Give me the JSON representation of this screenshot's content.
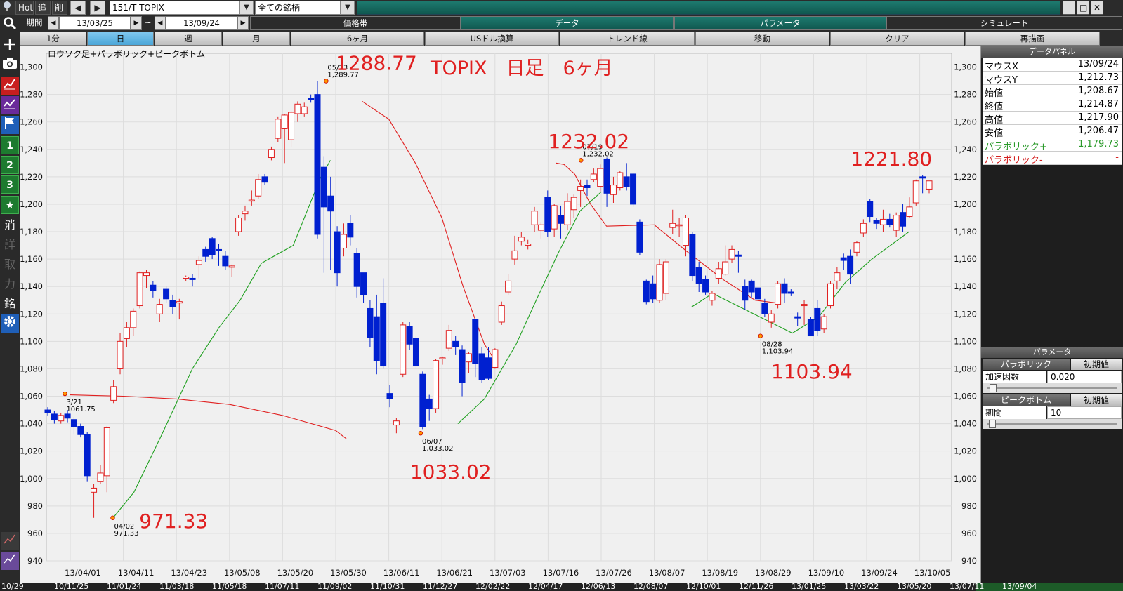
{
  "toolbar": {
    "hot": "Hot",
    "add": "追",
    "del": "削",
    "symbol": "151/T TOPIX",
    "universe": "全ての銘柄",
    "period_label": "期間",
    "date_from": "13/03/25",
    "tilde": "~",
    "date_to": "13/09/24"
  },
  "header_tabs": [
    "価格帯",
    "データ",
    "パラメータ",
    "シミュレート"
  ],
  "interval_tabs": [
    "1分",
    "日",
    "週",
    "月",
    "6ヶ月",
    "USドル換算",
    "トレンド線",
    "移動",
    "クリア",
    "再描画"
  ],
  "leftbar": [
    "1",
    "2",
    "3",
    "★",
    "消",
    "詳",
    "取",
    "力",
    "銘"
  ],
  "chart": {
    "subtitle": "ロウソク足+パラボリック+ピークボトム",
    "title": "TOPIX　日足　6ヶ月"
  },
  "chart_data": {
    "type": "candlestick",
    "title": "TOPIX　日足　6ヶ月",
    "ylim": [
      940,
      1310
    ],
    "yticks": [
      940,
      960,
      980,
      1000,
      1020,
      1040,
      1060,
      1080,
      1100,
      1120,
      1140,
      1160,
      1180,
      1200,
      1220,
      1240,
      1260,
      1280,
      1300
    ],
    "xticks": [
      "13/04/01",
      "13/04/11",
      "13/04/23",
      "13/05/08",
      "13/05/20",
      "13/05/30",
      "13/06/11",
      "13/06/21",
      "13/07/03",
      "13/07/16",
      "13/07/26",
      "13/08/07",
      "13/08/19",
      "13/08/29",
      "13/09/10",
      "13/09/24",
      "13/10/05"
    ],
    "big_labels": [
      {
        "text": "1288.77",
        "x": 5,
        "y": 1298
      },
      {
        "text": "1232.02",
        "x": 9,
        "y": 1241
      },
      {
        "text": "1221.80",
        "x": 14.7,
        "y": 1228
      },
      {
        "text": "1103.94",
        "x": 13.2,
        "y": 1073
      },
      {
        "text": "1033.02",
        "x": 6.4,
        "y": 1000
      },
      {
        "text": "971.33",
        "x": 1.3,
        "y": 964
      }
    ],
    "peaks": [
      {
        "date": "05/23",
        "value": "1,289.77",
        "x": 4.82,
        "y": 1289.77
      },
      {
        "date": "06/07",
        "value": "1,033.02",
        "x": 6.6,
        "y": 1033.02
      },
      {
        "date": "07/19",
        "value": "1,232.02",
        "x": 9.62,
        "y": 1232.02
      },
      {
        "date": "08/28",
        "value": "1,103.94",
        "x": 13.0,
        "y": 1103.94
      },
      {
        "date": "04/02",
        "value": "971.33",
        "x": 0.8,
        "y": 971.33
      },
      {
        "date": "3/21",
        "value": "1061.75",
        "x": -0.1,
        "y": 1061.75
      }
    ],
    "candles": [
      [
        1050,
        1048,
        1052,
        1046
      ],
      [
        1047,
        1043,
        1049,
        1040
      ],
      [
        1042,
        1046,
        1048,
        1040
      ],
      [
        1047,
        1044,
        1050,
        1041
      ],
      [
        1043,
        1038,
        1045,
        1032
      ],
      [
        1038,
        1032,
        1040,
        1030
      ],
      [
        1032,
        1002,
        1034,
        998
      ],
      [
        990,
        993,
        996,
        971.33
      ],
      [
        998,
        1004,
        1010,
        996
      ],
      [
        1002,
        1037,
        1038,
        990
      ],
      [
        1057,
        1067,
        1072,
        1055
      ],
      [
        1080,
        1100,
        1106,
        1076
      ],
      [
        1102,
        1110,
        1114,
        1096
      ],
      [
        1110,
        1122,
        1124,
        1104
      ],
      [
        1126,
        1150,
        1151,
        1124
      ],
      [
        1148,
        1150,
        1152,
        1139
      ],
      [
        1141,
        1137,
        1144,
        1132
      ],
      [
        1120,
        1127,
        1131,
        1114
      ],
      [
        1138,
        1131,
        1140,
        1128
      ],
      [
        1130,
        1125,
        1134,
        1120
      ],
      [
        1128,
        1129,
        1131,
        1116
      ],
      [
        1146,
        1147,
        1148,
        1144
      ],
      [
        1146,
        1145,
        1149,
        1140
      ],
      [
        1156,
        1159,
        1162,
        1146
      ],
      [
        1167,
        1162,
        1169,
        1158
      ],
      [
        1175,
        1163,
        1176,
        1160
      ],
      [
        1167,
        1166,
        1171,
        1155
      ],
      [
        1162,
        1155,
        1166,
        1152
      ],
      [
        1154,
        1155,
        1156,
        1147
      ],
      [
        1180,
        1190,
        1192,
        1177
      ],
      [
        1193,
        1195,
        1199,
        1188
      ],
      [
        1203,
        1203,
        1210,
        1199
      ],
      [
        1206,
        1218,
        1222,
        1204
      ],
      [
        1220,
        1216,
        1222,
        1214
      ],
      [
        1234,
        1240,
        1242,
        1232
      ],
      [
        1248,
        1262,
        1264,
        1245
      ],
      [
        1255,
        1265,
        1266,
        1230
      ],
      [
        1247,
        1267,
        1268,
        1242
      ],
      [
        1266,
        1273,
        1275,
        1260
      ],
      [
        1266,
        1271,
        1274,
        1264
      ],
      [
        1277,
        1276,
        1280,
        1274
      ],
      [
        1280,
        1178,
        1289.77,
        1175
      ],
      [
        1227,
        1198,
        1235,
        1150
      ],
      [
        1206,
        1195,
        1220,
        1152
      ],
      [
        1180,
        1150,
        1184,
        1140
      ],
      [
        1168,
        1178,
        1186,
        1162
      ],
      [
        1186,
        1176,
        1192,
        1170
      ],
      [
        1164,
        1140,
        1168,
        1132
      ],
      [
        1150,
        1134,
        1150,
        1128
      ],
      [
        1124,
        1103,
        1130,
        1096
      ],
      [
        1118,
        1086,
        1134,
        1076
      ],
      [
        1128,
        1082,
        1146,
        1080
      ],
      [
        1062,
        1058,
        1068,
        1052
      ],
      [
        1039,
        1042,
        1044,
        1033.02
      ],
      [
        1076,
        1112,
        1114,
        1074
      ],
      [
        1111,
        1098,
        1114,
        1094
      ],
      [
        1102,
        1082,
        1104,
        1080
      ],
      [
        1076,
        1038,
        1078,
        1036
      ],
      [
        1058,
        1051,
        1061,
        1042
      ],
      [
        1051,
        1086,
        1087,
        1048
      ],
      [
        1088,
        1088,
        1089,
        1083
      ],
      [
        1095,
        1108,
        1112,
        1093
      ],
      [
        1100,
        1096,
        1104,
        1090
      ],
      [
        1094,
        1070,
        1097,
        1060
      ],
      [
        1085,
        1091,
        1092,
        1077
      ],
      [
        1116,
        1084,
        1116,
        1074
      ],
      [
        1091,
        1072,
        1096,
        1070
      ],
      [
        1088,
        1073,
        1096,
        1072
      ],
      [
        1081,
        1094,
        1095,
        1080
      ],
      [
        1114,
        1126,
        1129,
        1112
      ],
      [
        1136,
        1144,
        1149,
        1134
      ],
      [
        1160,
        1166,
        1177,
        1156
      ],
      [
        1173,
        1176,
        1180,
        1170
      ],
      [
        1170,
        1171,
        1174,
        1167
      ],
      [
        1185,
        1195,
        1198,
        1180
      ],
      [
        1181,
        1185,
        1187,
        1175
      ],
      [
        1205,
        1180,
        1210,
        1176
      ],
      [
        1182,
        1199,
        1200,
        1176
      ],
      [
        1192,
        1186,
        1199,
        1175
      ],
      [
        1185,
        1202,
        1208,
        1181
      ],
      [
        1196,
        1205,
        1207,
        1190
      ],
      [
        1210,
        1213,
        1218,
        1198
      ],
      [
        1214,
        1212,
        1218,
        1206
      ],
      [
        1218,
        1222,
        1226,
        1216
      ],
      [
        1213,
        1226,
        1229,
        1209
      ],
      [
        1233,
        1208,
        1234,
        1198
      ],
      [
        1207,
        1214,
        1220,
        1201
      ],
      [
        1212,
        1223,
        1224,
        1210
      ],
      [
        1220,
        1213,
        1230,
        1210
      ],
      [
        1222,
        1200,
        1223,
        1198
      ],
      [
        1187,
        1165,
        1189,
        1163
      ],
      [
        1144,
        1129,
        1145,
        1127
      ],
      [
        1142,
        1131,
        1148,
        1128
      ],
      [
        1130,
        1156,
        1160,
        1128
      ],
      [
        1135,
        1158,
        1160,
        1130
      ],
      [
        1183,
        1186,
        1196,
        1178
      ],
      [
        1185,
        1185,
        1190,
        1176
      ],
      [
        1170,
        1190,
        1192,
        1162
      ],
      [
        1178,
        1148,
        1180,
        1144
      ],
      [
        1154,
        1142,
        1158,
        1136
      ],
      [
        1145,
        1136,
        1148,
        1134
      ],
      [
        1130,
        1135,
        1137,
        1126
      ],
      [
        1146,
        1153,
        1158,
        1142
      ],
      [
        1149,
        1158,
        1170,
        1148
      ],
      [
        1160,
        1167,
        1170,
        1157
      ],
      [
        1163,
        1162,
        1166,
        1150
      ],
      [
        1140,
        1130,
        1145,
        1123
      ],
      [
        1144,
        1136,
        1145,
        1132
      ],
      [
        1139,
        1131,
        1147,
        1120
      ],
      [
        1128,
        1120,
        1131,
        1118
      ],
      [
        1114,
        1120,
        1123,
        1110
      ],
      [
        1127,
        1142,
        1144,
        1124
      ],
      [
        1142,
        1135,
        1146,
        1128
      ],
      [
        1136,
        1135,
        1138,
        1133
      ],
      [
        1118,
        1117,
        1121,
        1111
      ],
      [
        1126,
        1127,
        1130,
        1112
      ],
      [
        1116,
        1104,
        1118,
        1103.94
      ],
      [
        1124,
        1108,
        1130,
        1104
      ],
      [
        1109,
        1118,
        1120,
        1106
      ],
      [
        1126,
        1142,
        1144,
        1124
      ],
      [
        1144,
        1150,
        1154,
        1138
      ],
      [
        1161,
        1159,
        1164,
        1152
      ],
      [
        1162,
        1149,
        1167,
        1142
      ],
      [
        1165,
        1172,
        1173,
        1162
      ],
      [
        1179,
        1186,
        1189,
        1176
      ],
      [
        1202,
        1191,
        1204,
        1187
      ],
      [
        1188,
        1186,
        1190,
        1182
      ],
      [
        1185,
        1189,
        1196,
        1180
      ],
      [
        1189,
        1185,
        1193,
        1183
      ],
      [
        1181,
        1192,
        1194,
        1176
      ],
      [
        1194,
        1184,
        1200,
        1180
      ],
      [
        1191,
        1198,
        1205,
        1190
      ],
      [
        1201,
        1217,
        1218,
        1199
      ],
      [
        1220,
        1219,
        1221,
        1208
      ],
      [
        1211,
        1217,
        1216,
        1208
      ]
    ],
    "sar_minus": [
      [
        0,
        1061
      ],
      [
        1,
        1060
      ],
      [
        2,
        1058
      ],
      [
        3,
        1054
      ],
      [
        4,
        1046
      ],
      [
        5,
        1035
      ],
      [
        5.2,
        1029
      ],
      [
        5.5,
        1275
      ],
      [
        6,
        1262
      ],
      [
        6.5,
        1230
      ],
      [
        7,
        1190
      ],
      [
        7.4,
        1140
      ],
      [
        7.8,
        1098
      ],
      [
        8.0,
        1086
      ],
      [
        9.15,
        1230
      ],
      [
        9.3,
        1229
      ],
      [
        9.5,
        1222
      ],
      [
        9.8,
        1200
      ],
      [
        10.1,
        1184
      ],
      [
        11.0,
        1185
      ],
      [
        11.6,
        1166
      ],
      [
        12.3,
        1145
      ],
      [
        12.9,
        1130
      ],
      [
        13.3,
        1128
      ]
    ],
    "sar_plus": [
      [
        0.8,
        971
      ],
      [
        1.2,
        990
      ],
      [
        1.7,
        1030
      ],
      [
        2.3,
        1080
      ],
      [
        2.8,
        1110
      ],
      [
        3.2,
        1130
      ],
      [
        3.6,
        1157
      ],
      [
        4.2,
        1170
      ],
      [
        4.7,
        1218
      ],
      [
        4.9,
        1232
      ],
      [
        7.3,
        1040
      ],
      [
        7.8,
        1058
      ],
      [
        8.4,
        1098
      ],
      [
        8.8,
        1132
      ],
      [
        9.2,
        1165
      ],
      [
        9.6,
        1195
      ],
      [
        10.0,
        1209
      ],
      [
        11.7,
        1125
      ],
      [
        12.1,
        1135
      ],
      [
        13.6,
        1106
      ],
      [
        14.1,
        1118
      ],
      [
        14.6,
        1143
      ],
      [
        15.1,
        1160
      ],
      [
        15.8,
        1180
      ]
    ]
  },
  "data_panel": {
    "header": "データパネル",
    "rows": [
      {
        "k": "マウスX",
        "v": "13/09/24"
      },
      {
        "k": "マウスY",
        "v": "1,212.73"
      },
      {
        "k": "始値",
        "v": "1,208.67"
      },
      {
        "k": "終値",
        "v": "1,214.87"
      },
      {
        "k": "高値",
        "v": "1,217.90"
      },
      {
        "k": "安値",
        "v": "1,206.47"
      },
      {
        "k": "パラボリック+",
        "v": "1,179.73",
        "color": "#2a9a2a"
      },
      {
        "k": "パラボリック-",
        "v": "-",
        "color": "#d42020"
      }
    ]
  },
  "params": {
    "header": "パラメータ",
    "parabolic": "パラボリック",
    "init": "初期値",
    "accel_label": "加速因数",
    "accel_value": "0.020",
    "peak": "ピークボトム",
    "period_label": "期間",
    "period_value": "10"
  },
  "bottom_dates": [
    "10/29",
    "10/11/25",
    "11/01/24",
    "11/03/18",
    "11/05/18",
    "11/07/11",
    "11/09/02",
    "11/10/31",
    "11/12/27",
    "12/02/22",
    "12/04/17",
    "12/06/13",
    "12/08/07",
    "12/10/01",
    "12/11/26",
    "13/01/25",
    "13/03/22",
    "13/05/20",
    "13/07/11",
    "13/09/04"
  ],
  "colors": {
    "up": "#e02020",
    "down": "#0020d0",
    "sar_plus": "#20a020",
    "sar_minus": "#e02020"
  }
}
